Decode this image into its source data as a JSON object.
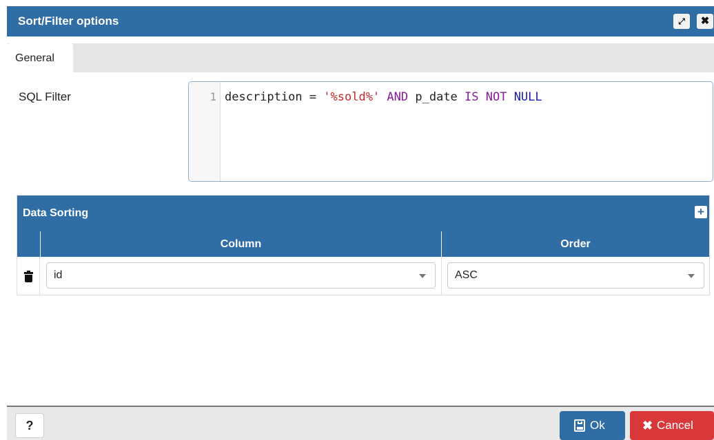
{
  "dialog": {
    "title": "Sort/Filter options",
    "maximize_icon": "expand-arrows-icon",
    "close_icon": "close-x-icon"
  },
  "tabs": [
    {
      "label": "General",
      "active": true
    }
  ],
  "sql_filter": {
    "label": "SQL Filter",
    "line_number": "1",
    "tokens": {
      "t1": "description = ",
      "t2": "'%sold%'",
      "t3": " AND",
      "t4": " p_date ",
      "t5": "IS NOT",
      "t6": " NULL"
    }
  },
  "data_sorting": {
    "title": "Data Sorting",
    "add_icon": "plus-icon",
    "headers": {
      "column": "Column",
      "order": "Order"
    },
    "rows": [
      {
        "delete_icon": "trash-icon",
        "column": "id",
        "order": "ASC"
      }
    ]
  },
  "footer": {
    "help_label": "?",
    "ok_label": "Ok",
    "ok_icon": "save-floppy-icon",
    "cancel_label": "Cancel",
    "cancel_icon": "x-icon"
  },
  "colors": {
    "header_blue": "#2f6da4",
    "cancel_red": "#d9383a",
    "string_red": "#c62828",
    "keyword_purple": "#8a1a9c",
    "keyword_blue": "#1a1aa6"
  }
}
